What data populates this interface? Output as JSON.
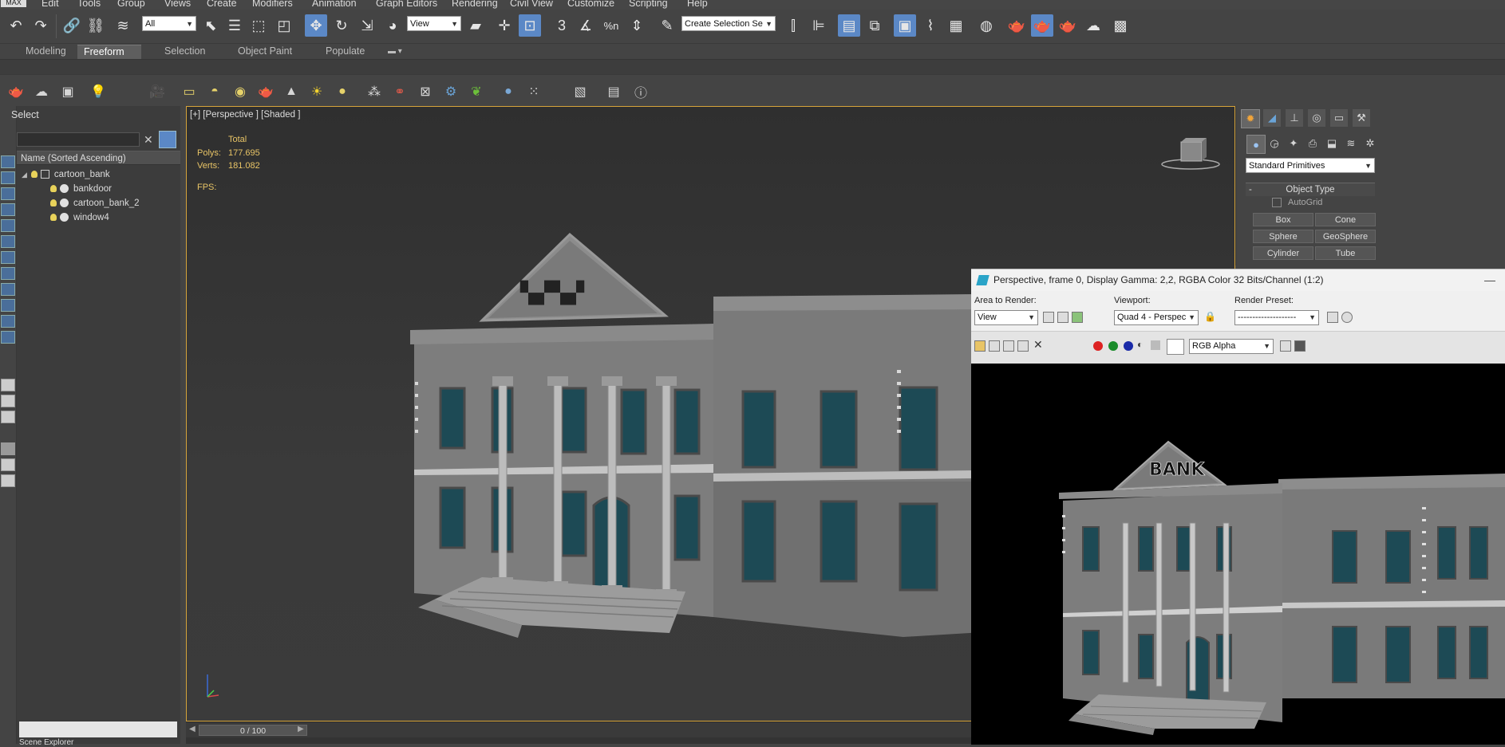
{
  "app": {
    "logo": "MAX"
  },
  "menu": [
    "Edit",
    "Tools",
    "Group",
    "Views",
    "Create",
    "Modifiers",
    "Animation",
    "Graph Editors",
    "Rendering",
    "Civil View",
    "Customize",
    "Scripting",
    "Help"
  ],
  "main_toolbar": {
    "selection_filter": "All",
    "reference_coord": "View",
    "named_selection": "Create Selection Se",
    "percent_snap_label": "%n"
  },
  "ribbon_tabs": {
    "items": [
      "Modeling",
      "Freeform",
      "Selection",
      "Object Paint",
      "Populate"
    ],
    "active": "Freeform"
  },
  "explorer": {
    "title": "Select",
    "column_header": "Name (Sorted Ascending)",
    "items": [
      {
        "name": "cartoon_bank",
        "level": 0,
        "expanded": true
      },
      {
        "name": "bankdoor",
        "level": 1
      },
      {
        "name": "cartoon_bank_2",
        "level": 1
      },
      {
        "name": "window4",
        "level": 1
      }
    ],
    "footer": "Scene Explorer"
  },
  "viewport": {
    "label": "[+] [Perspective ] [Shaded ]",
    "stats_header": "Total",
    "polys_label": "Polys:",
    "polys": "177.695",
    "verts_label": "Verts:",
    "verts": "181.082",
    "fps_label": "FPS:"
  },
  "timeline": {
    "frame": "0 / 100"
  },
  "command_panel": {
    "category": "Standard Primitives",
    "rollout": "Object Type",
    "autogrid": "AutoGrid",
    "buttons": [
      "Box",
      "Cone",
      "Sphere",
      "GeoSphere",
      "Cylinder",
      "Tube"
    ]
  },
  "render_window": {
    "title": "Perspective, frame 0, Display Gamma: 2,2, RGBA Color 32 Bits/Channel (1:2)",
    "area_label": "Area to Render:",
    "area_value": "View",
    "viewport_label": "Viewport:",
    "viewport_value": "Quad 4 - Perspec",
    "preset_label": "Render Preset:",
    "preset_value": "--------------------",
    "channel_value": "RGB Alpha",
    "sign_text": "BANK"
  },
  "colors": {
    "accent": "#5b88c6",
    "viewport_border": "#d6a43a",
    "stats": "#e8c466",
    "window_glass": "#1d4a55"
  }
}
